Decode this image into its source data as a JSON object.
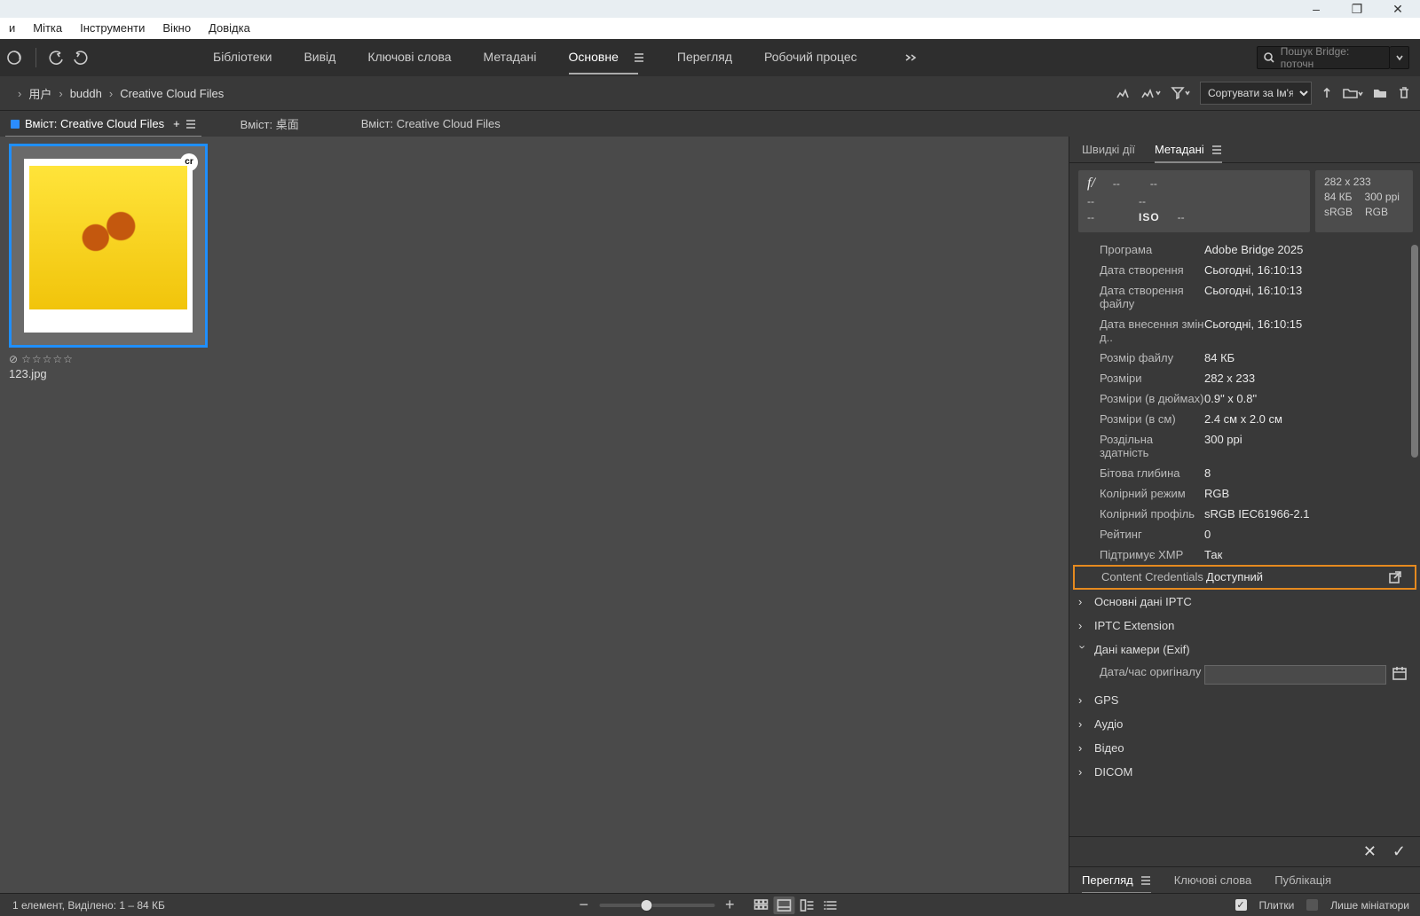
{
  "window_controls": {
    "min": "–",
    "max": "❐",
    "close": "✕"
  },
  "menubar": [
    "и",
    "Мітка",
    "Інструменти",
    "Вікно",
    "Довідка"
  ],
  "workspace_tabs": [
    "Бібліотеки",
    "Вивід",
    "Ключові слова",
    "Метадані",
    "Основне",
    "Перегляд",
    "Робочий процес"
  ],
  "workspace_active_index": 4,
  "search_placeholder": "Пошук Bridge: поточн",
  "breadcrumbs": [
    "用户",
    "buddh",
    "Creative Cloud Files"
  ],
  "sort_label": "Сортувати за Ім'я ф…",
  "content_tabs": [
    {
      "label": "Вміст: Creative Cloud Files",
      "active": true,
      "plus": true,
      "menu": true
    },
    {
      "label": "Вміст: 桌面",
      "active": false
    },
    {
      "label": "Вміст: Creative Cloud Files",
      "active": false
    }
  ],
  "thumb_badge": "cr",
  "thumb_filename": "123.jpg",
  "rp_tabs": [
    "Швидкі дії",
    "Метадані"
  ],
  "rp_active_index": 1,
  "summary": {
    "pixels": "282 x 233",
    "size": "84 КБ",
    "ppi": "300 ppi",
    "cs": "sRGB",
    "mode": "RGB",
    "iso_label": "ISO",
    "dash": "--"
  },
  "meta_rows": [
    {
      "k": "Програма",
      "v": "Adobe Bridge 2025"
    },
    {
      "k": "Дата створення",
      "v": "Сьогодні, 16:10:13"
    },
    {
      "k": "Дата створення файлу",
      "v": "Сьогодні, 16:10:13"
    },
    {
      "k": "Дата внесення змін д..",
      "v": "Сьогодні, 16:10:15"
    },
    {
      "k": "Розмір файлу",
      "v": "84 КБ"
    },
    {
      "k": "Розміри",
      "v": "282 x 233"
    },
    {
      "k": "Розміри (в дюймах)",
      "v": "0.9\" x 0.8\""
    },
    {
      "k": "Розміри (в см)",
      "v": "2.4 см x 2.0 см"
    },
    {
      "k": "Роздільна здатність",
      "v": "300 ppi"
    },
    {
      "k": "Бітова глибина",
      "v": "8"
    },
    {
      "k": "Колірний режим",
      "v": "RGB"
    },
    {
      "k": "Колірний профіль",
      "v": "sRGB IEC61966-2.1"
    },
    {
      "k": "Рейтинг",
      "v": "0"
    },
    {
      "k": "Підтримує XMP",
      "v": "Так"
    },
    {
      "k": "Content Credentials",
      "v": "Доступний",
      "hl": true
    }
  ],
  "meta_sections": [
    {
      "label": "Основні дані IPTC",
      "exp": false
    },
    {
      "label": "IPTC Extension",
      "exp": false
    },
    {
      "label": "Дані камери (Exif)",
      "exp": true,
      "field_label": "Дата/час оригіналу"
    },
    {
      "label": "GPS",
      "exp": false
    },
    {
      "label": "Аудіо",
      "exp": false
    },
    {
      "label": "Відео",
      "exp": false
    },
    {
      "label": "DICOM",
      "exp": false
    }
  ],
  "rp_btabs": [
    "Перегляд",
    "Ключові слова",
    "Публікація"
  ],
  "rp_btabs_active": 0,
  "status": {
    "info": "1 елемент, Виділено: 1 – 84 КБ",
    "tiles": "Плитки",
    "thumbs_only": "Лише мініатюри"
  }
}
